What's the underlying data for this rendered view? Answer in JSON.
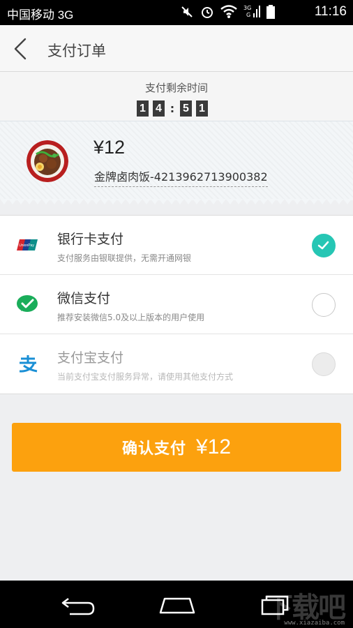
{
  "status_bar": {
    "carrier": "中国移动 3G",
    "network_small_top": "3G",
    "network_small_bottom": "G",
    "time": "11:16"
  },
  "header": {
    "title": "支付订单"
  },
  "countdown": {
    "label": "支付剩余时间",
    "digits": [
      "1",
      "4",
      "5",
      "1"
    ]
  },
  "order": {
    "price": "¥12",
    "name": "金牌卤肉饭-4213962713900382"
  },
  "payment_methods": [
    {
      "name": "银行卡支付",
      "desc": "支付服务由银联提供，无需开通网银",
      "icon": "unionpay-icon",
      "state": "selected"
    },
    {
      "name": "微信支付",
      "desc": "推荐安装微信5.0及以上版本的用户使用",
      "icon": "wechat-pay-icon",
      "state": "unselected"
    },
    {
      "name": "支付宝支付",
      "desc": "当前支付宝支付服务异常，请使用其他支付方式",
      "icon": "alipay-icon",
      "state": "disabled"
    }
  ],
  "confirm": {
    "label": "确认支付",
    "amount": "¥12"
  },
  "watermark": {
    "text": "下载吧",
    "url": "www.xiazaiba.com"
  },
  "colors": {
    "accent_orange": "#fca10e",
    "selected_teal": "#26c6b4",
    "wechat_green": "#1aad5a",
    "alipay_blue": "#1a8fd5",
    "unionpay_red": "#d6262d"
  }
}
